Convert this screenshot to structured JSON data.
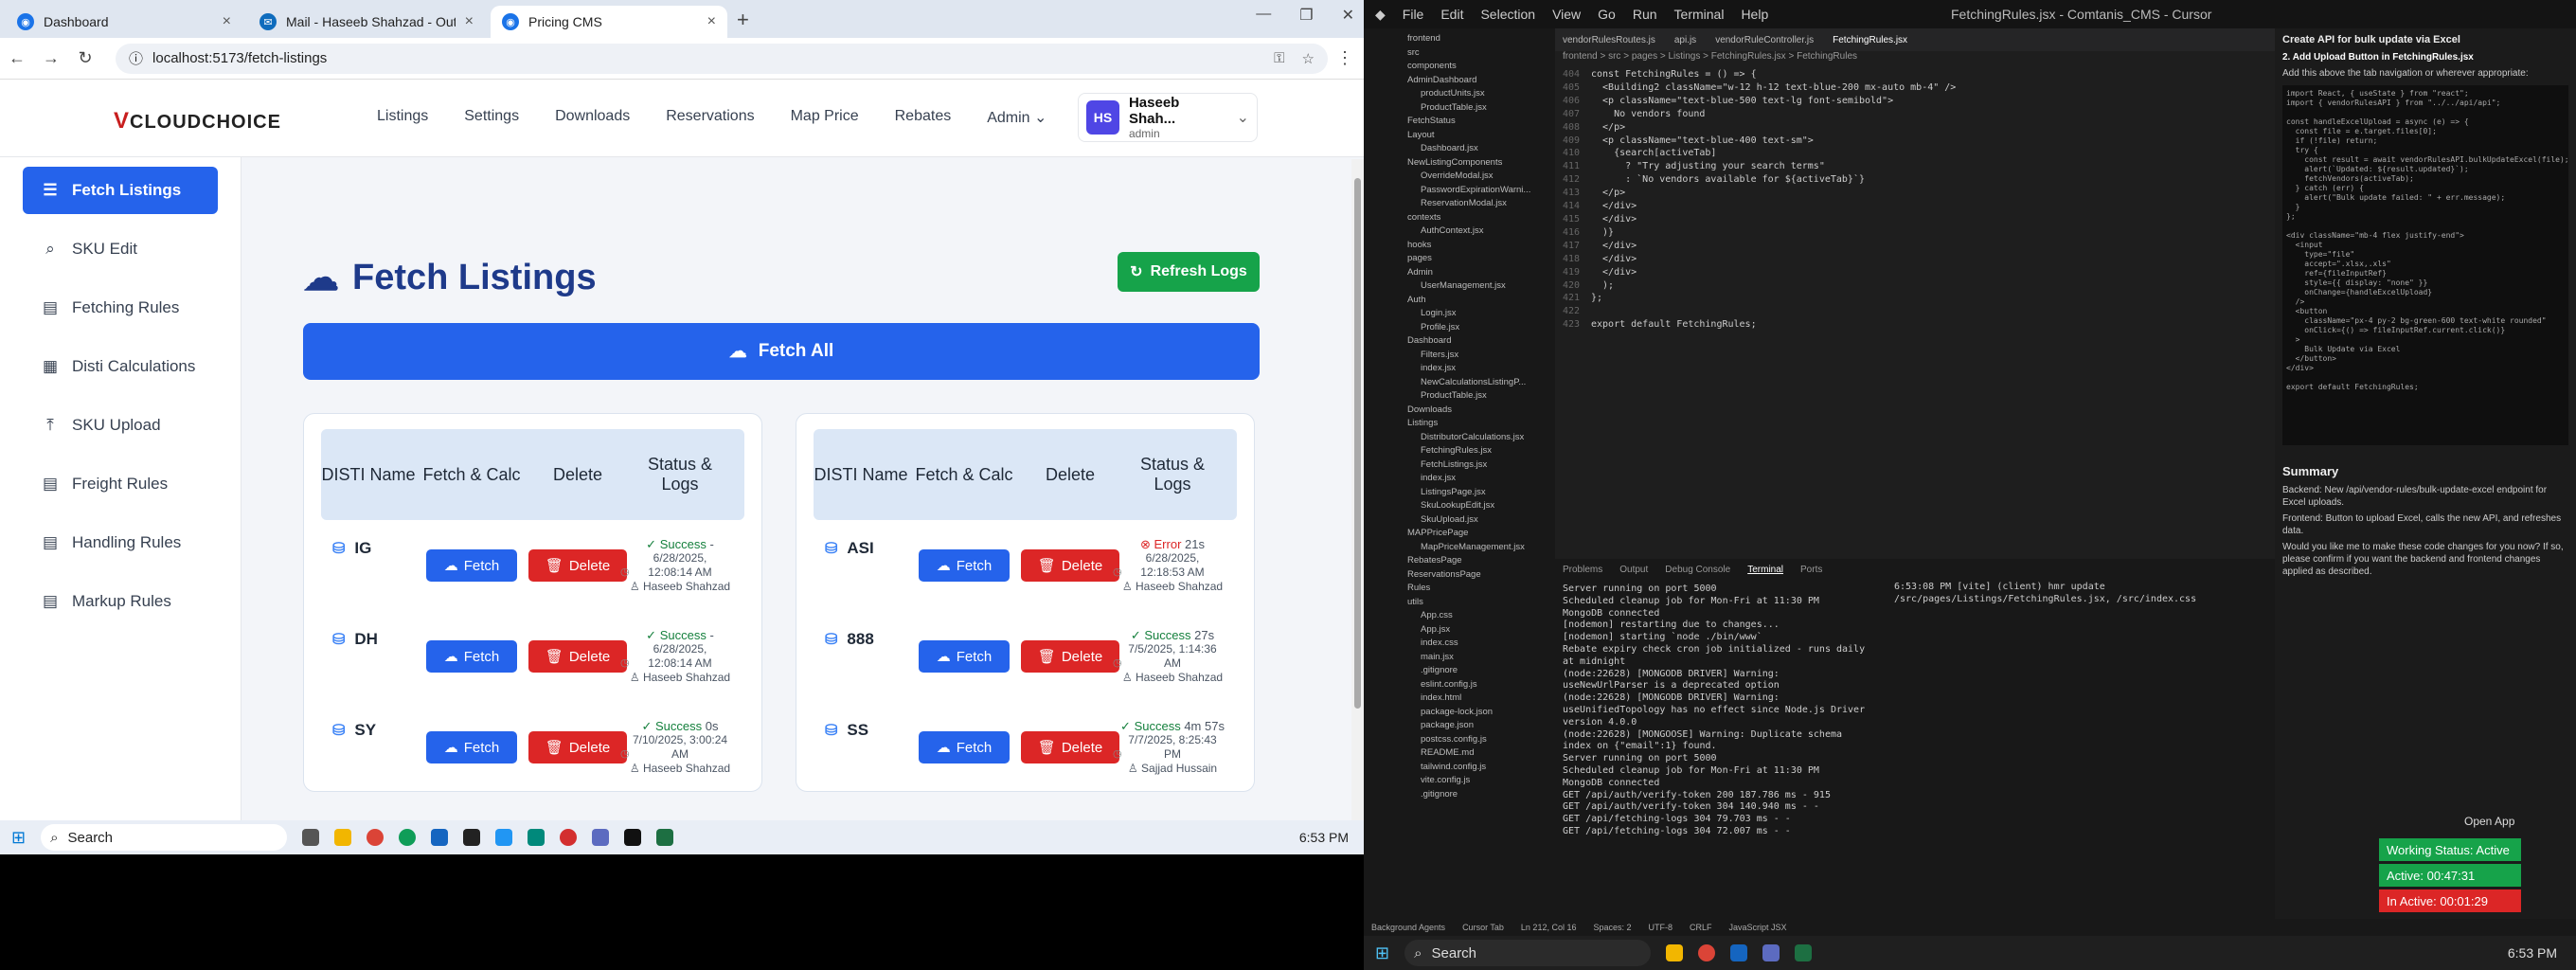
{
  "browser": {
    "tabs": [
      {
        "label": "Dashboard",
        "color": "#1a73e8"
      },
      {
        "label": "Mail - Haseeb Shahzad - Outlo",
        "color": "#0f6cbd"
      },
      {
        "label": "Pricing CMS",
        "color": "#1a73e8"
      }
    ],
    "url": "localhost:5173/fetch-listings"
  },
  "app": {
    "logo": "CLOUDCHOICE",
    "nav": [
      "Listings",
      "Settings",
      "Downloads",
      "Reservations",
      "Map Price",
      "Rebates",
      "Admin"
    ],
    "user": {
      "initials": "HS",
      "name": "Haseeb Shah...",
      "role": "admin"
    },
    "sidebar": [
      {
        "label": "Fetch Listings",
        "icon": "list-icon"
      },
      {
        "label": "SKU Edit",
        "icon": "search-icon"
      },
      {
        "label": "Fetching Rules",
        "icon": "book-icon"
      },
      {
        "label": "Disti Calculations",
        "icon": "calculator-icon"
      },
      {
        "label": "SKU Upload",
        "icon": "upload-icon"
      },
      {
        "label": "Freight Rules",
        "icon": "book-icon"
      },
      {
        "label": "Handling Rules",
        "icon": "book-icon"
      },
      {
        "label": "Markup Rules",
        "icon": "book-icon"
      }
    ],
    "page_title": "Fetch Listings",
    "refresh_label": "Refresh Logs",
    "fetch_all_label": "Fetch All",
    "table_headers": [
      "DISTI Name",
      "Fetch & Calc",
      "Delete",
      "Status & Logs"
    ],
    "fetch_label": "Fetch",
    "delete_label": "Delete",
    "left_rows": [
      {
        "name": "IG",
        "status": "Success",
        "dur": "-",
        "date": "6/28/2025,",
        "time": "12:08:14 AM",
        "user": "Haseeb Shahzad",
        "ok": true
      },
      {
        "name": "DH",
        "status": "Success",
        "dur": "-",
        "date": "6/28/2025,",
        "time": "12:08:14 AM",
        "user": "Haseeb Shahzad",
        "ok": true
      },
      {
        "name": "SY",
        "status": "Success",
        "dur": "0s",
        "date": "7/10/2025, 3:00:24",
        "time": "AM",
        "user": "Haseeb Shahzad",
        "ok": true
      }
    ],
    "right_rows": [
      {
        "name": "ASI",
        "status": "Error",
        "dur": "21s",
        "date": "6/28/2025,",
        "time": "12:18:53 AM",
        "user": "Haseeb Shahzad",
        "ok": false
      },
      {
        "name": "888",
        "status": "Success",
        "dur": "27s",
        "date": "7/5/2025, 1:14:36",
        "time": "AM",
        "user": "Haseeb Shahzad",
        "ok": true
      },
      {
        "name": "SS",
        "status": "Success",
        "dur": "4m 57s",
        "date": "7/7/2025, 8:25:43",
        "time": "PM",
        "user": "Sajjad Hussain",
        "ok": true
      }
    ]
  },
  "taskbar": {
    "search": "Search",
    "time": "6:53 PM"
  },
  "editor": {
    "title": "FetchingRules.jsx - Comtanis_CMS - Cursor",
    "menu": [
      "File",
      "Edit",
      "Selection",
      "View",
      "Go",
      "Run",
      "Terminal",
      "Help"
    ],
    "tabs": [
      "vendorRulesRoutes.js",
      "api.js",
      "vendorRuleController.js",
      "FetchingRules.jsx"
    ],
    "breadcrumb": "frontend > src > pages > Listings > FetchingRules.jsx > FetchingRules",
    "code": [
      "const FetchingRules = () => {",
      "  <Building2 className=\"w-12 h-12 text-blue-200 mx-auto mb-4\" />",
      "  <p className=\"text-blue-500 text-lg font-semibold\">",
      "    No vendors found",
      "  </p>",
      "  <p className=\"text-blue-400 text-sm\">",
      "    {search[activeTab]",
      "      ? \"Try adjusting your search terms\"",
      "      : `No vendors available for ${activeTab}`}",
      "  </p>",
      "  </div>",
      "  </div>",
      "  )}",
      "  </div>",
      "  </div>",
      "  </div>",
      "  );",
      "};",
      "",
      "export default FetchingRules;"
    ],
    "explorer": [
      "frontend",
      "src",
      "components",
      "AdminDashboard",
      "productUnits.jsx",
      "ProductTable.jsx",
      "FetchStatus",
      "Layout",
      "Dashboard.jsx",
      "NewListingComponents",
      "OverrideModal.jsx",
      "PasswordExpirationWarni...",
      "ReservationModal.jsx",
      "contexts",
      "AuthContext.jsx",
      "hooks",
      "pages",
      "Admin",
      "UserManagement.jsx",
      "Auth",
      "Login.jsx",
      "Profile.jsx",
      "Dashboard",
      "Filters.jsx",
      "index.jsx",
      "NewCalculationsListingP...",
      "ProductTable.jsx",
      "Downloads",
      "Listings",
      "DistributorCalculations.jsx",
      "FetchingRules.jsx",
      "FetchListings.jsx",
      "index.jsx",
      "ListingsPage.jsx",
      "SkuLookupEdit.jsx",
      "SkuUpload.jsx",
      "MAPPricePage",
      "MapPriceManagement.jsx",
      "RebatesPage",
      "ReservationsPage",
      "Rules",
      "utils",
      "App.css",
      "App.jsx",
      "index.css",
      "main.jsx",
      ".gitignore",
      "eslint.config.js",
      "index.html",
      "package-lock.json",
      "package.json",
      "postcss.config.js",
      "README.md",
      "tailwind.config.js",
      "vite.config.js",
      ".gitignore"
    ],
    "terminal_tabs": [
      "Problems",
      "Output",
      "Debug Console",
      "Terminal",
      "Ports"
    ],
    "terminal": [
      "Server running on port 5000",
      "Scheduled cleanup job for Mon-Fri at 11:30 PM",
      "MongoDB connected",
      "[nodemon] restarting due to changes...",
      "[nodemon] starting `node ./bin/www`",
      "Rebate expiry check cron job initialized - runs daily at midnight",
      "(node:22628) [MONGODB DRIVER] Warning: useNewUrlParser is a deprecated option",
      "(node:22628) [MONGODB DRIVER] Warning: useUnifiedTopology has no effect since Node.js Driver version 4.0.0",
      "(node:22628) [MONGOOSE] Warning: Duplicate schema index on {\"email\":1} found.",
      "Server running on port 5000",
      "Scheduled cleanup job for Mon-Fri at 11:30 PM",
      "MongoDB connected",
      "GET /api/auth/verify-token 200 187.786 ms - 915",
      "GET /api/auth/verify-token 304 140.940 ms - -",
      "GET /api/fetching-logs 304 79.703 ms - -",
      "GET /api/fetching-logs 304 72.007 ms - -"
    ],
    "terminal_side": "6:53:08 PM [vite] (client) hmr update /src/pages/Listings/FetchingRules.jsx, /src/index.css",
    "chat_title": "Create API for bulk update via Excel",
    "chat_step": "2. Add Upload Button in FetchingRules.jsx",
    "chat_step_desc": "Add this above the tab navigation or wherever appropriate:",
    "chat_code": "import React, { useState } from \"react\";\nimport { vendorRulesAPI } from \"../../api/api\";\n\nconst handleExcelUpload = async (e) => {\n  const file = e.target.files[0];\n  if (!file) return;\n  try {\n    const result = await vendorRulesAPI.bulkUpdateExcel(file);\n    alert(`Updated: ${result.updated}`);\n    fetchVendors(activeTab);\n  } catch (err) {\n    alert(\"Bulk update failed: \" + err.message);\n  }\n};\n\n<div className=\"mb-4 flex justify-end\">\n  <input\n    type=\"file\"\n    accept=\".xlsx,.xls\"\n    ref={fileInputRef}\n    style={{ display: \"none\" }}\n    onChange={handleExcelUpload}\n  />\n  <button\n    className=\"px-4 py-2 bg-green-600 text-white rounded\"\n    onClick={() => fileInputRef.current.click()}\n  >\n    Bulk Update via Excel\n  </button>\n</div>\n\nexport default FetchingRules;",
    "summary_title": "Summary",
    "summary_1": "Backend: New /api/vendor-rules/bulk-update-excel endpoint for Excel uploads.",
    "summary_2": "Frontend: Button to upload Excel, calls the new API, and refreshes data.",
    "summary_q": "Would you like me to make these code changes for you now? If so, please confirm if you want the backend and frontend changes applied as described.",
    "working_status": "Working Status: Active",
    "active_time": "Active: 00:47:31",
    "inactive_time": "In Active: 00:01:29",
    "open_app": "Open App",
    "statusbar": [
      "Background Agents",
      "Cursor Tab",
      "Ln 212, Col 16",
      "Spaces: 2",
      "UTF-8",
      "CRLF",
      "JavaScript JSX"
    ]
  }
}
